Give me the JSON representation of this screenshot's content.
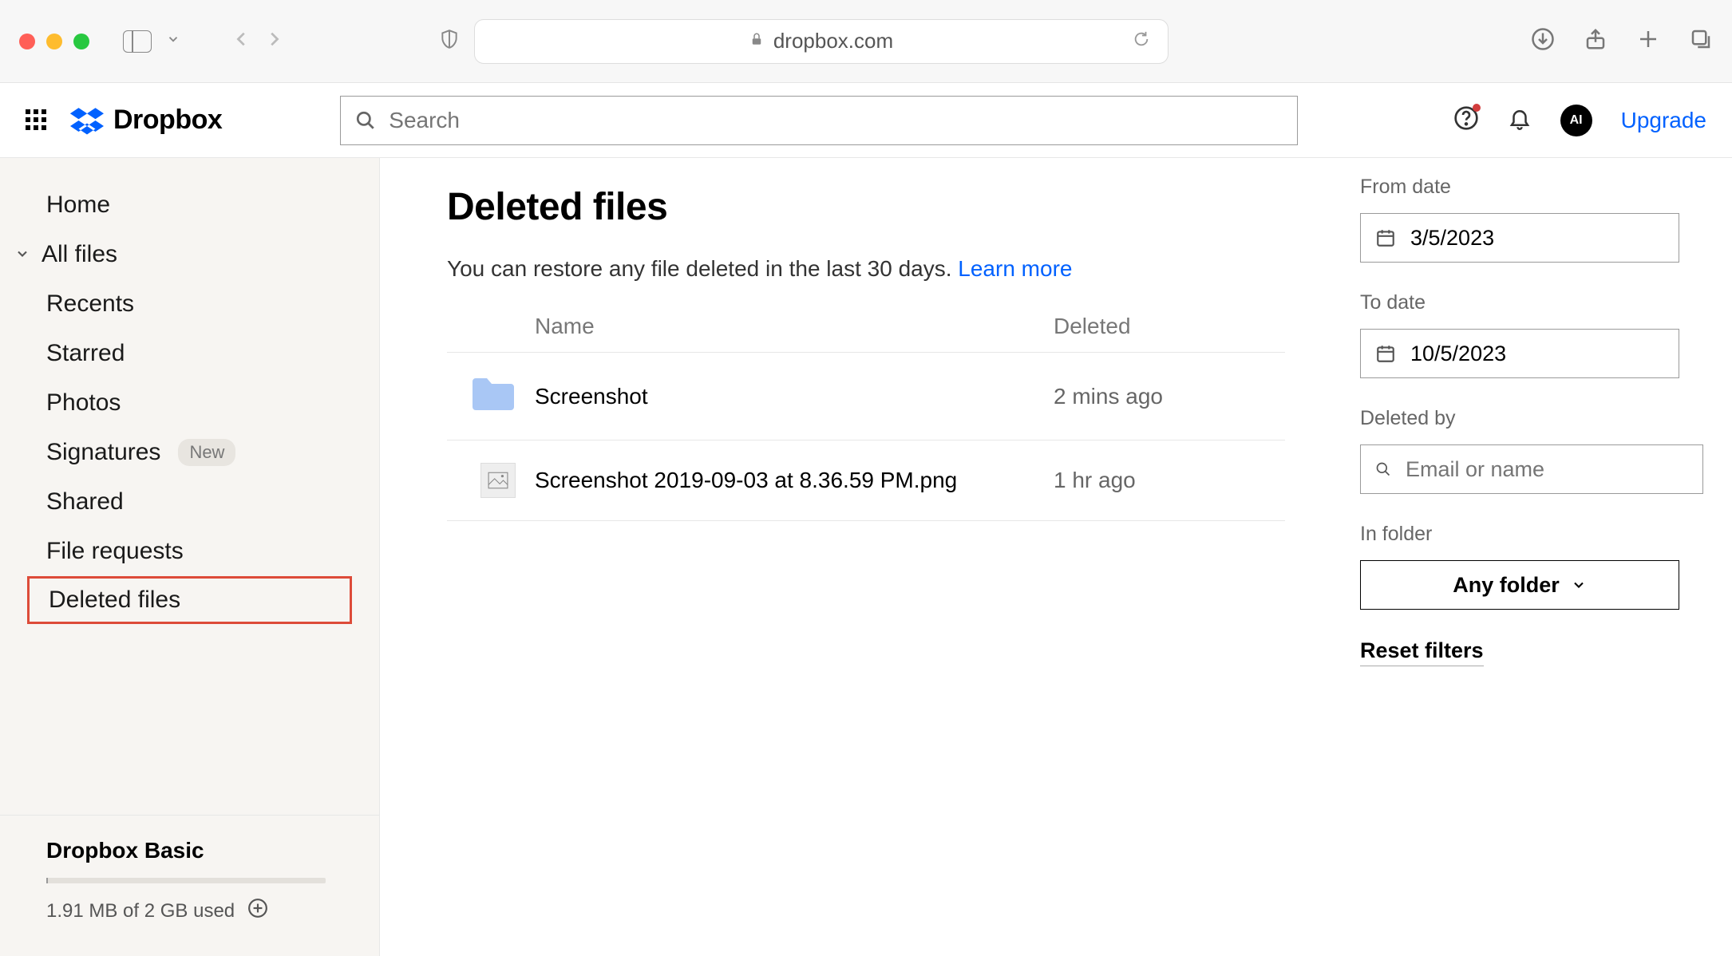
{
  "browser": {
    "url_display": "dropbox.com"
  },
  "header": {
    "brand": "Dropbox",
    "search_placeholder": "Search",
    "avatar_initials": "AI",
    "upgrade_label": "Upgrade"
  },
  "sidebar": {
    "items": [
      {
        "label": "Home"
      },
      {
        "label": "All files",
        "has_chevron": true
      },
      {
        "label": "Recents"
      },
      {
        "label": "Starred"
      },
      {
        "label": "Photos"
      },
      {
        "label": "Signatures",
        "badge": "New"
      },
      {
        "label": "Shared"
      },
      {
        "label": "File requests"
      },
      {
        "label": "Deleted files",
        "active": true
      }
    ],
    "footer": {
      "plan": "Dropbox Basic",
      "storage_text": "1.91 MB of 2 GB used"
    }
  },
  "main": {
    "title": "Deleted files",
    "subtitle_text": "You can restore any file deleted in the last 30 days. ",
    "learn_more": "Learn more",
    "columns": {
      "name": "Name",
      "deleted": "Deleted"
    },
    "rows": [
      {
        "type": "folder",
        "name": "Screenshot",
        "deleted": "2 mins ago"
      },
      {
        "type": "image",
        "name": "Screenshot 2019-09-03 at 8.36.59 PM.png",
        "deleted": "1 hr ago"
      }
    ]
  },
  "filters": {
    "from_label": "From date",
    "from_value": "3/5/2023",
    "to_label": "To date",
    "to_value": "10/5/2023",
    "deleted_by_label": "Deleted by",
    "deleted_by_placeholder": "Email or name",
    "in_folder_label": "In folder",
    "folder_select_label": "Any folder",
    "reset_label": "Reset filters"
  }
}
